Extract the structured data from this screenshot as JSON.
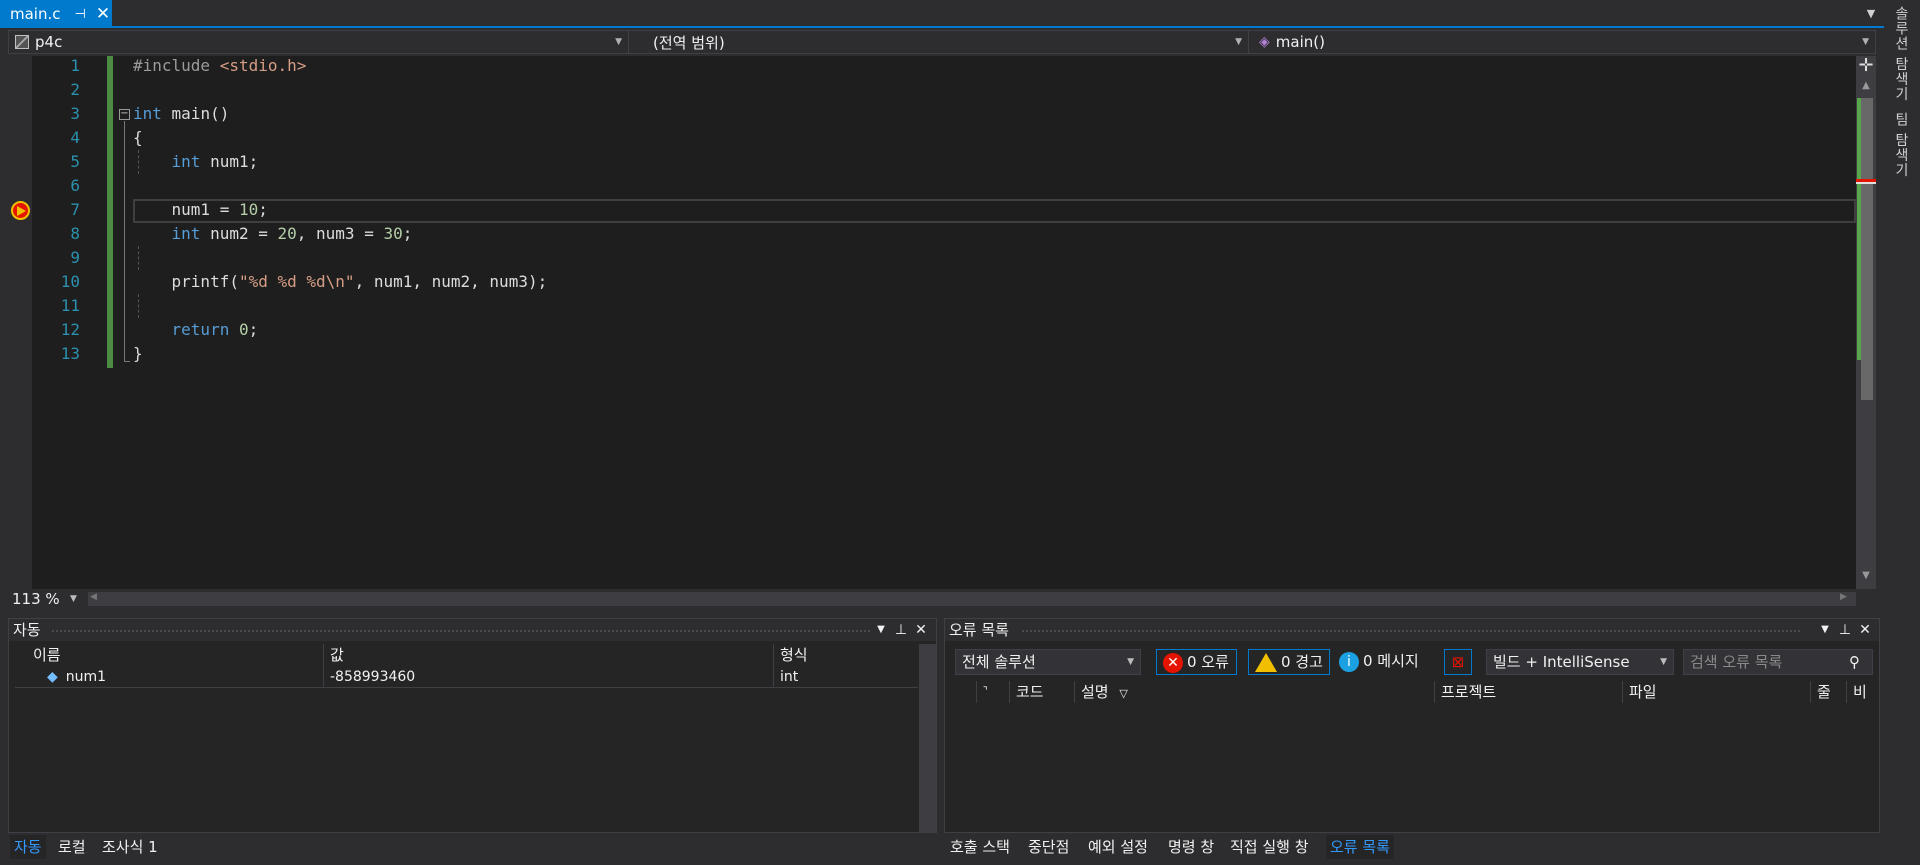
{
  "tabs": {
    "active": "main.c",
    "pin_glyph": "⊣",
    "close_glyph": "✕"
  },
  "right_strip": {
    "solution_explorer": "솔루션 탐색기",
    "team_explorer": "팀 탐색기"
  },
  "navbar": {
    "project": "p4c",
    "scope": "(전역 범위)",
    "member": "main()"
  },
  "editor": {
    "line_numbers": [
      "1",
      "2",
      "3",
      "4",
      "5",
      "6",
      "7",
      "8",
      "9",
      "10",
      "11",
      "12",
      "13"
    ],
    "current_line": 7,
    "zoom": "113 %"
  },
  "autos_panel": {
    "title": "자동",
    "columns": [
      "이름",
      "값",
      "형식"
    ],
    "rows": [
      {
        "name": "num1",
        "value": "-858993460",
        "type": "int"
      }
    ]
  },
  "error_panel": {
    "title": "오류 목록",
    "scope_combo": "전체 솔루션",
    "errors": "0 오류",
    "warnings": "0 경고",
    "messages": "0 메시지",
    "build_combo": "빌드 + IntelliSense",
    "search_placeholder": "검색 오류 목록",
    "columns": [
      "코드",
      "설명",
      "프로젝트",
      "파일",
      "줄",
      "비고"
    ]
  },
  "bottom_tabs_left": [
    "자동",
    "로컬",
    "조사식 1"
  ],
  "bottom_tabs_right": [
    "호출 스택",
    "중단점",
    "예외 설정",
    "명령 창",
    "직접 실행 창",
    "오류 목록"
  ],
  "colors": {
    "accent": "#007acc",
    "editor_bg": "#1e1e1e",
    "keyword": "#569cd6",
    "string": "#d69d85",
    "number": "#b5cea8",
    "line_number": "#2b91af"
  }
}
